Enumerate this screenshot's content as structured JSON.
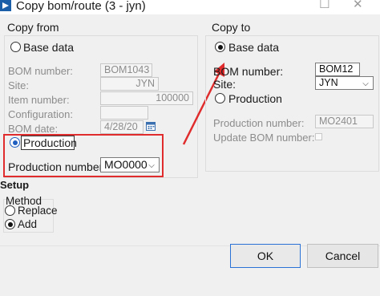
{
  "window": {
    "title": "Copy bom/route (3 - jyn)",
    "icon": "dynamics-app-icon",
    "minimize_glyph": "–",
    "maximize_glyph": "☐",
    "close_glyph": "✕"
  },
  "copy_from": {
    "title": "Copy from",
    "base_data_label": "Base data",
    "base_data_selected": false,
    "bom_number_label": "BOM number:",
    "bom_number_value": "BOM1043",
    "site_label": "Site:",
    "site_value": "JYN",
    "item_number_label": "Item number:",
    "item_number_value": "100000",
    "configuration_label": "Configuration:",
    "configuration_value": "",
    "bom_date_label": "BOM date:",
    "bom_date_value": "4/28/20",
    "production_label": "Production",
    "production_selected": true,
    "production_number_label": "Production number:",
    "production_number_value": "MO0000"
  },
  "copy_to": {
    "title": "Copy to",
    "base_data_label": "Base data",
    "base_data_selected": true,
    "bom_number_label": "BOM number:",
    "bom_number_value": "BOM12",
    "site_label": "Site:",
    "site_value": "JYN",
    "production_label": "Production",
    "production_selected": false,
    "production_number_label": "Production number:",
    "production_number_value": "MO2401",
    "update_bom_label": "Update BOM number:",
    "update_bom_checked": false
  },
  "setup": {
    "title": "Setup",
    "method_title": "Method",
    "replace_label": "Replace",
    "replace_selected": false,
    "add_label": "Add",
    "add_selected": true
  },
  "buttons": {
    "ok_label": "OK",
    "cancel_label": "Cancel"
  },
  "annotation": {
    "highlight_color": "#e02c2c"
  }
}
